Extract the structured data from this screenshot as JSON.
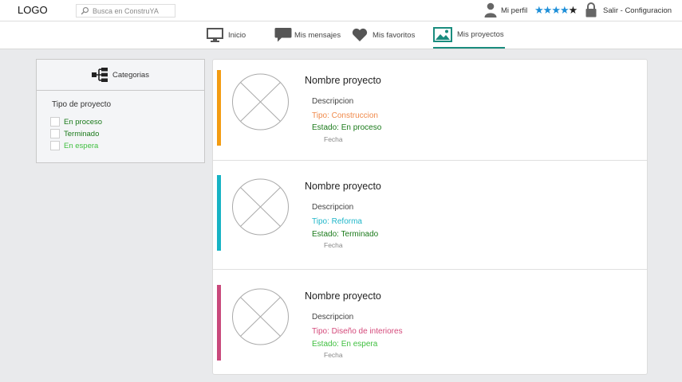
{
  "header": {
    "logo": "LOGO",
    "search_placeholder": "Busca en ConstruYA",
    "profile_label": "Mi perfil",
    "rating": {
      "value": 4,
      "max": 5
    },
    "logout_label": "Salir - Configuracion"
  },
  "nav": {
    "items": [
      {
        "label": "Inicio",
        "icon": "monitor-icon"
      },
      {
        "label": "Mis mensajes",
        "icon": "speech-bubble-icon"
      },
      {
        "label": "Mis favoritos",
        "icon": "heart-icon"
      },
      {
        "label": "Mis proyectos",
        "icon": "image-icon",
        "active": true
      }
    ]
  },
  "sidebar": {
    "header_label": "Categorias",
    "header_icon": "hierarchy-icon",
    "filter_title": "Tipo de proyecto",
    "filters": [
      {
        "label": "En proceso",
        "color": "#1a7a1a",
        "checked": false
      },
      {
        "label": "Terminado",
        "color": "#1a7a1a",
        "checked": false
      },
      {
        "label": "En espera",
        "color": "#3fbf3f",
        "checked": false
      }
    ]
  },
  "projects": [
    {
      "title": "Nombre proyecto",
      "description": "Descripcion",
      "type": "Tipo: Construccion",
      "type_color": "#f08a4b",
      "state": "Estado: En proceso",
      "state_color": "#1a7a1a",
      "date": "Fecha",
      "accent_color": "#f39c12"
    },
    {
      "title": "Nombre proyecto",
      "description": "Descripcion",
      "type": "Tipo: Reforma",
      "type_color": "#1fb6c9",
      "state": "Estado: Terminado",
      "state_color": "#1a7a1a",
      "date": "Fecha",
      "accent_color": "#17b3c4"
    },
    {
      "title": "Nombre proyecto",
      "description": "Descripcion",
      "type": "Tipo: Diseño de interiores",
      "type_color": "#d4497a",
      "state": "Estado: En espera",
      "state_color": "#3fbf3f",
      "date": "Fecha",
      "accent_color": "#c9497c"
    }
  ]
}
